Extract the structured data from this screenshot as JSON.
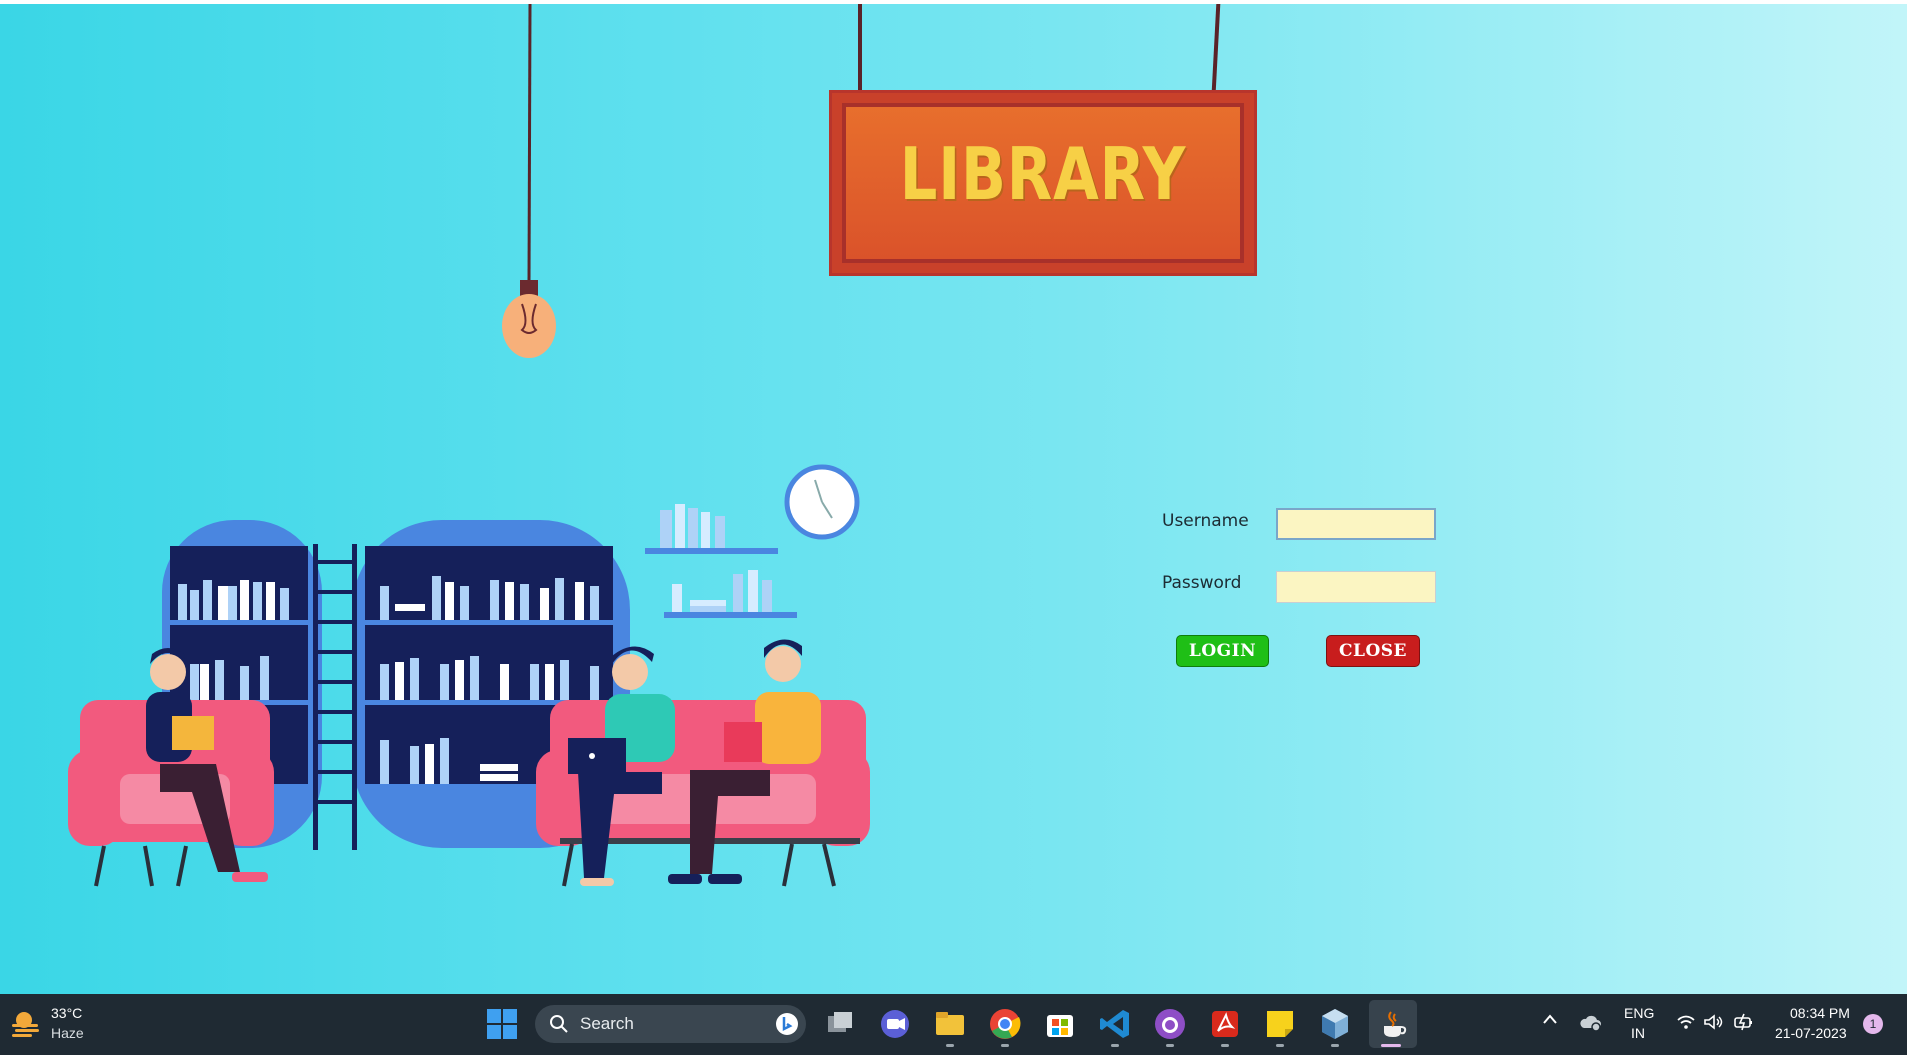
{
  "sign": {
    "text": "LIBRARY"
  },
  "login_form": {
    "username_label": "Username",
    "username_value": "",
    "password_label": "Password",
    "password_value": "",
    "login_label": "LOGIN",
    "close_label": "CLOSE"
  },
  "taskbar": {
    "weather_temp": "33°C",
    "weather_condition": "Haze",
    "search_label": "Search",
    "pinned_apps": [
      "start-icon",
      "task-view-icon",
      "chat-icon",
      "file-explorer-icon",
      "chrome-icon",
      "microsoft-store-icon",
      "vscode-icon",
      "github-desktop-icon",
      "acrobat-icon",
      "sticky-notes-icon",
      "netbeans-icon",
      "java-icon"
    ],
    "language_line1": "ENG",
    "language_line2": "IN",
    "time": "08:34 PM",
    "date": "21-07-2023",
    "notification_count": "1"
  },
  "colors": {
    "background_start": "#3ad6e6",
    "background_end": "#c2f5f9",
    "login_button": "#1fbf16",
    "close_button": "#c81d1d",
    "field_bg": "#fbf5c2",
    "taskbar": "#1f2a33"
  }
}
